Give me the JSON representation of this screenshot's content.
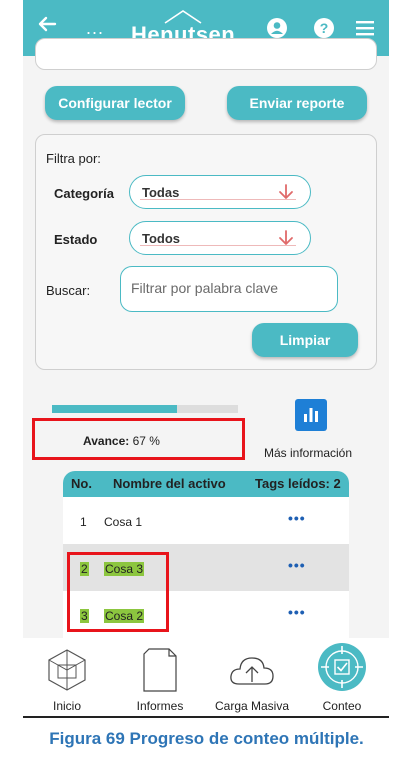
{
  "appbar": {
    "back_icon": "arrow-left-icon",
    "more_label": "...",
    "logo_text": "Henutsen",
    "icons": [
      "user-icon",
      "help-icon",
      "menu-icon"
    ]
  },
  "actions": {
    "configure_label": "Configurar lector",
    "report_label": "Enviar reporte"
  },
  "filters": {
    "title": "Filtra por:",
    "category_label": "Categoría",
    "category_value": "Todas",
    "state_label": "Estado",
    "state_value": "Todos",
    "search_label": "Buscar:",
    "search_placeholder": "Filtrar por palabra clave",
    "clear_label": "Limpiar"
  },
  "progress": {
    "label": "Avance:",
    "value_text": "67 %",
    "fraction": 0.67,
    "more_info_label": "Más información"
  },
  "table": {
    "headers": {
      "no": "No.",
      "name": "Nombre del activo",
      "tags": "Tags leídos: 2"
    },
    "rows": [
      {
        "no": "1",
        "name": "Cosa 1",
        "more": "•••"
      },
      {
        "no": "2",
        "name": "Cosa 3",
        "more": "•••"
      },
      {
        "no": "3",
        "name": "Cosa 2",
        "more": "•••"
      }
    ]
  },
  "nav": {
    "items": [
      "Inicio",
      "Informes",
      "Carga Masiva",
      "Conteo"
    ]
  },
  "caption": "Figura 69 Progreso de conteo múltiple.",
  "colors": {
    "accent": "#4bbac4",
    "highlight": "#8cc63f",
    "annotation_red": "#e8141b",
    "info_blue": "#1e7fd6",
    "caption_blue": "#2e75b6"
  }
}
